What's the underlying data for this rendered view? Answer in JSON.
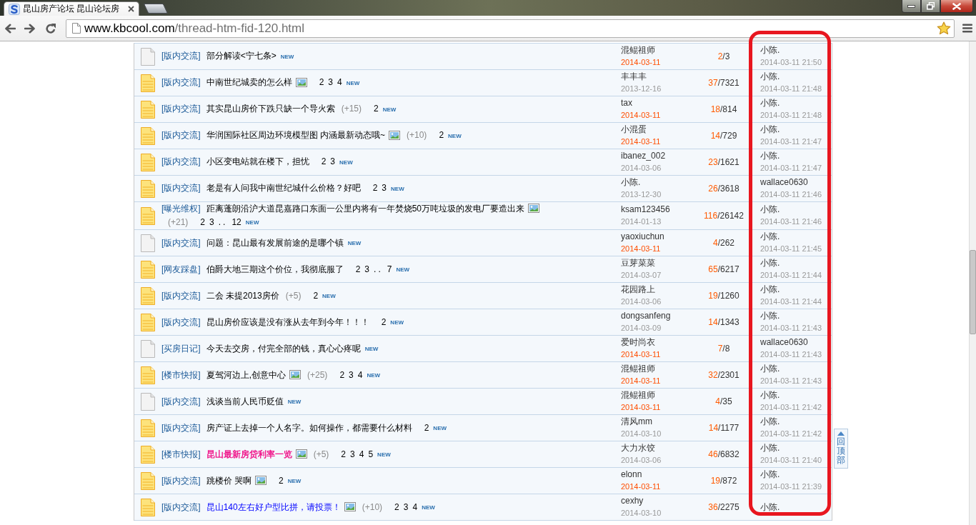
{
  "browser": {
    "tab_title": "昆山房产论坛 昆山论坛房",
    "url_host": "www.kbcool.com",
    "url_path": "/thread-htm-fid-120.html"
  },
  "count_separator": "/",
  "threads": [
    {
      "hot": false,
      "category": "[版内交流]",
      "title": "部分解读<宁七条>",
      "bold": false,
      "image": false,
      "badge": "NEW",
      "author": "混鲲祖师",
      "date": "2014-03-11",
      "today": true,
      "replies": "2",
      "views": "3",
      "last_poster": "小陈.",
      "last_time": "2014-03-11 21:50"
    },
    {
      "hot": true,
      "category": "[版内交流]",
      "title": "中南世纪城卖的怎么样",
      "bold": false,
      "image": true,
      "pages": [
        "2",
        "3",
        "4"
      ],
      "badge": "NEW",
      "author": "丰丰丰",
      "date": "2013-12-16",
      "today": false,
      "replies": "37",
      "views": "7321",
      "last_poster": "小陈.",
      "last_time": "2014-03-11 21:48"
    },
    {
      "hot": true,
      "category": "[版内交流]",
      "title": "其实昆山房价下跌只缺一个导火索",
      "bold": false,
      "image": false,
      "plus": "(+15)",
      "pages": [
        "2"
      ],
      "badge": "NEW",
      "author": "tax",
      "date": "2014-03-11",
      "today": true,
      "replies": "18",
      "views": "814",
      "last_poster": "小陈.",
      "last_time": "2014-03-11 21:48"
    },
    {
      "hot": true,
      "category": "[版内交流]",
      "title": "华润国际社区周边环境模型图 内涵最新动态哦~",
      "bold": false,
      "image": true,
      "plus": "(+10)",
      "pages": [
        "2"
      ],
      "badge": "NEW",
      "author": "小混蛋",
      "date": "2014-03-11",
      "today": true,
      "replies": "14",
      "views": "729",
      "last_poster": "小陈.",
      "last_time": "2014-03-11 21:47"
    },
    {
      "hot": true,
      "category": "[版内交流]",
      "title": "小区变电站就在楼下，担忧",
      "bold": false,
      "image": false,
      "pages": [
        "2",
        "3"
      ],
      "badge": "NEW",
      "author": "ibanez_002",
      "date": "2014-03-06",
      "today": false,
      "replies": "23",
      "views": "1621",
      "last_poster": "小陈.",
      "last_time": "2014-03-11 21:47"
    },
    {
      "hot": true,
      "category": "[版内交流]",
      "title": "老是有人问我中南世纪城什么价格？好吧",
      "bold": false,
      "image": false,
      "pages": [
        "2",
        "3"
      ],
      "badge": "NEW",
      "author": "小陈.",
      "date": "2013-12-30",
      "today": false,
      "replies": "26",
      "views": "3618",
      "last_poster": "wallace0630",
      "last_time": "2014-03-11 21:46"
    },
    {
      "hot": true,
      "category": "[曝光维权]",
      "title": "距离蓬朗沿沪大道昆嘉路口东面一公里内将有一年焚烧50万吨垃圾的发电厂要造出来",
      "bold": false,
      "image": true,
      "plus": "(+21)",
      "pages": [
        "2",
        "3"
      ],
      "ellipsis": "..",
      "last_page": "12",
      "badge": "NEW",
      "author": "ksam123456",
      "date": "2014-01-13",
      "today": false,
      "replies": "116",
      "views": "26142",
      "last_poster": "小陈.",
      "last_time": "2014-03-11 21:46"
    },
    {
      "hot": false,
      "category": "[版内交流]",
      "title": "问题：昆山最有发展前途的是哪个镇",
      "bold": false,
      "image": false,
      "badge": "NEW",
      "author": "yaoxiuchun",
      "date": "2014-03-11",
      "today": true,
      "replies": "4",
      "views": "262",
      "last_poster": "小陈.",
      "last_time": "2014-03-11 21:45"
    },
    {
      "hot": true,
      "category": "[网友踩盘]",
      "title": "伯爵大地三期这个价位，我彻底服了",
      "bold": false,
      "image": false,
      "pages": [
        "2",
        "3"
      ],
      "ellipsis": "..",
      "last_page": "7",
      "badge": "NEW",
      "author": "豆芽菜菜",
      "date": "2014-03-07",
      "today": false,
      "replies": "65",
      "views": "6217",
      "last_poster": "小陈.",
      "last_time": "2014-03-11 21:44"
    },
    {
      "hot": true,
      "category": "[版内交流]",
      "title": "二会 未提2013房价",
      "bold": false,
      "image": false,
      "plus": "(+5)",
      "pages": [
        "2"
      ],
      "badge": "NEW",
      "author": "花园路上",
      "date": "2014-03-06",
      "today": false,
      "replies": "19",
      "views": "1260",
      "last_poster": "小陈.",
      "last_time": "2014-03-11 21:44"
    },
    {
      "hot": true,
      "category": "[版内交流]",
      "title": "昆山房价应该是没有涨从去年到今年！！！",
      "bold": false,
      "image": false,
      "pages": [
        "2"
      ],
      "badge": "NEW",
      "author": "dongsanfeng",
      "date": "2014-03-09",
      "today": false,
      "replies": "14",
      "views": "1343",
      "last_poster": "小陈.",
      "last_time": "2014-03-11 21:43"
    },
    {
      "hot": false,
      "category": "[买房日记]",
      "title": "今天去交房，付完全部的钱，真心心疼呢",
      "bold": false,
      "image": false,
      "badge": "NEW",
      "author": "爱时尚衣",
      "date": "2014-03-11",
      "today": true,
      "replies": "7",
      "views": "8",
      "last_poster": "wallace0630",
      "last_time": "2014-03-11 21:43"
    },
    {
      "hot": true,
      "category": "[楼市快报]",
      "title": "夏驾河边上,创意中心",
      "bold": false,
      "image": true,
      "plus": "(+25)",
      "pages": [
        "2",
        "3",
        "4"
      ],
      "badge": "NEW",
      "author": "混鲲祖师",
      "date": "2014-03-11",
      "today": true,
      "replies": "32",
      "views": "2301",
      "last_poster": "小陈.",
      "last_time": "2014-03-11 21:43"
    },
    {
      "hot": false,
      "category": "[版内交流]",
      "title": "浅谈当前人民币贬值",
      "bold": false,
      "image": false,
      "badge": "NEW",
      "author": "混鲲祖师",
      "date": "2014-03-11",
      "today": true,
      "replies": "4",
      "views": "35",
      "last_poster": "小陈.",
      "last_time": "2014-03-11 21:42"
    },
    {
      "hot": true,
      "category": "[版内交流]",
      "title": "房产证上去掉一个人名字。如何操作，都需要什么材料",
      "bold": false,
      "image": false,
      "pages": [
        "2"
      ],
      "badge": "NEW",
      "author": "清风mm",
      "date": "2014-03-10",
      "today": false,
      "replies": "14",
      "views": "1177",
      "last_poster": "小陈.",
      "last_time": "2014-03-11 21:42"
    },
    {
      "hot": true,
      "category": "[楼市快报]",
      "title": "昆山最新房贷利率一览",
      "color": "#f0188c",
      "bold": true,
      "image": true,
      "plus": "(+5)",
      "pages": [
        "2",
        "3",
        "4",
        "5"
      ],
      "badge": "NEW",
      "author": "大力水饺",
      "date": "2014-03-06",
      "today": false,
      "replies": "46",
      "views": "6832",
      "last_poster": "小陈.",
      "last_time": "2014-03-11 21:40"
    },
    {
      "hot": true,
      "category": "[版内交流]",
      "title": "跳楼价 哭啊",
      "bold": false,
      "image": true,
      "pages": [
        "2"
      ],
      "badge": "NEW",
      "author": "elonn",
      "date": "2014-03-11",
      "today": true,
      "replies": "19",
      "views": "872",
      "last_poster": "小陈.",
      "last_time": "2014-03-11 21:39"
    },
    {
      "hot": true,
      "category": "[版内交流]",
      "title": "昆山140左右好户型比拼，请投票！",
      "color": "#0000ff",
      "bold": false,
      "image": true,
      "plus": "(+10)",
      "pages": [
        "2",
        "3",
        "4"
      ],
      "badge": "NEW",
      "author": "cexhy",
      "date": "2014-03-10",
      "today": false,
      "replies": "36",
      "views": "2275",
      "last_poster": "小陈."
    }
  ],
  "back_to_top": "回顶部",
  "annotation": {
    "outline_last_reply_column": true
  }
}
